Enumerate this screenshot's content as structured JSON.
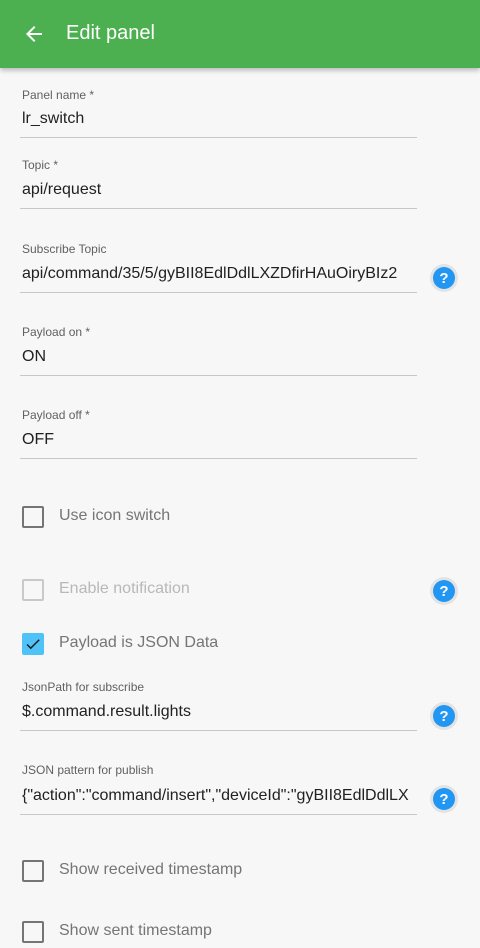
{
  "appbar": {
    "title": "Edit panel",
    "back_icon": "arrow-left-icon",
    "background": "#4caf50"
  },
  "fields": {
    "panel_name": {
      "label": "Panel name *",
      "value": "lr_switch"
    },
    "topic": {
      "label": "Topic *",
      "value": "api/request"
    },
    "subscribe_topic": {
      "label": "Subscribe Topic",
      "value": "api/command/35/5/gyBII8EdlDdlLXZDfirHAuOiryBIz2"
    },
    "payload_on": {
      "label": "Payload on *",
      "value": "ON"
    },
    "payload_off": {
      "label": "Payload off *",
      "value": "OFF"
    },
    "jsonpath_subscribe": {
      "label": "JsonPath for subscribe",
      "value": "$.command.result.lights"
    },
    "json_pattern_publish": {
      "label": "JSON pattern for publish",
      "value": "{\"action\":\"command/insert\",\"deviceId\":\"gyBII8EdlDdlLX"
    }
  },
  "checkboxes": {
    "use_icon_switch": {
      "label": "Use icon switch",
      "checked": false,
      "enabled": true
    },
    "enable_notification": {
      "label": "Enable notification",
      "checked": false,
      "enabled": false
    },
    "payload_is_json": {
      "label": "Payload is JSON Data",
      "checked": true,
      "enabled": true
    },
    "show_received_timestamp": {
      "label": "Show received timestamp",
      "checked": false,
      "enabled": true
    },
    "show_sent_timestamp": {
      "label": "Show sent timestamp",
      "checked": false,
      "enabled": true
    }
  },
  "help_icon": {
    "glyph": "?",
    "name": "help-icon",
    "color": "#2196f3"
  }
}
